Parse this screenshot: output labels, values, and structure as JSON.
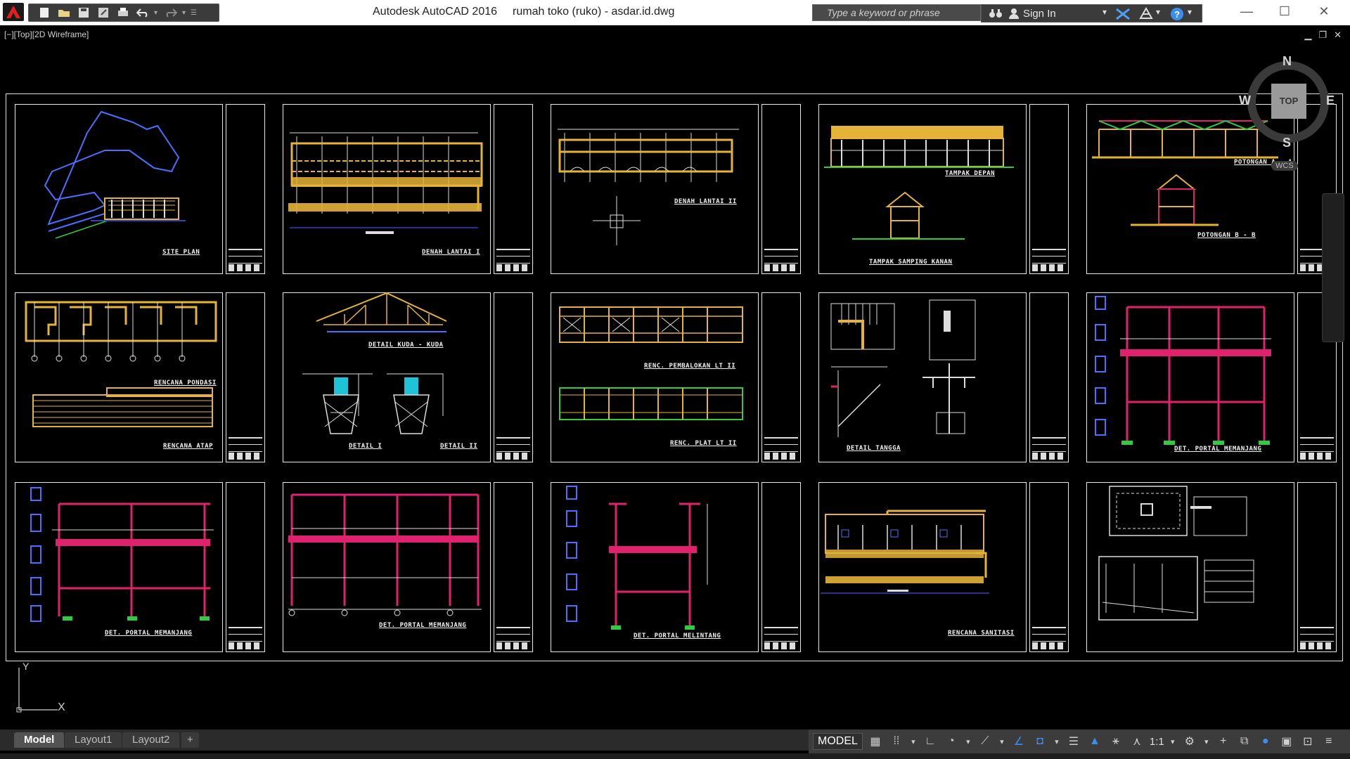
{
  "window": {
    "app_title": "Autodesk AutoCAD 2016",
    "file_title": "rumah toko (ruko) - asdar.id.dwg",
    "search_placeholder": "Type a keyword or phrase",
    "sign_in_label": "Sign In"
  },
  "viewport": {
    "label": "[−][Top][2D Wireframe]"
  },
  "viewcube": {
    "north": "N",
    "south": "S",
    "east": "E",
    "west": "W",
    "face": "TOP",
    "wcs_label": "WCS"
  },
  "ucs": {
    "y_label": "Y",
    "x_label": "X"
  },
  "sheets": [
    {
      "label": "SITE PLAN"
    },
    {
      "label": "DENAH LANTAI I"
    },
    {
      "label": "DENAH LANTAI II"
    },
    {
      "label": "TAMPAK DEPAN",
      "label2": "TAMPAK SAMPING KANAN"
    },
    {
      "label": "POTONGAN A - A",
      "label2": "POTONGAN B - B"
    },
    {
      "label": "RENCANA PONDASI",
      "label2": "RENCANA ATAP"
    },
    {
      "label": "DETAIL KUDA - KUDA",
      "label2": "DETAIL I",
      "label3": "DETAIL II"
    },
    {
      "label": "RENC. PEMBALOKAN LT II",
      "label2": "RENC. PLAT LT II"
    },
    {
      "label": "DETAIL TANGGA"
    },
    {
      "label": "DET. PORTAL MEMANJANG"
    },
    {
      "label": "DET. PORTAL MEMANJANG"
    },
    {
      "label": "DET. PORTAL MEMANJANG"
    },
    {
      "label": "DET. PORTAL MELINTANG"
    },
    {
      "label": "RENCANA SANITASI"
    },
    {
      "label": ""
    }
  ],
  "tabs": {
    "model": "Model",
    "layout1": "Layout1",
    "layout2": "Layout2",
    "add": "+"
  },
  "status": {
    "model": "MODEL",
    "scale": "1:1"
  },
  "colors": {
    "gold": "#e5b33a",
    "magenta": "#e0226e",
    "blue": "#3a6cf0",
    "cyan": "#1ec3d8",
    "green": "#2ecc40"
  }
}
